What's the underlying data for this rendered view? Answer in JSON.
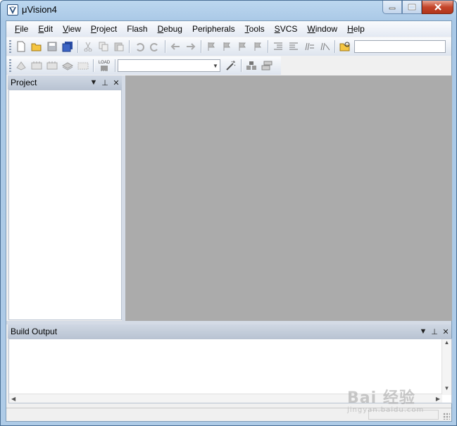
{
  "window": {
    "title": "μVision4"
  },
  "menu": [
    {
      "label": "File",
      "accel": "F",
      "rest": "ile"
    },
    {
      "label": "Edit",
      "accel": "E",
      "rest": "dit"
    },
    {
      "label": "View",
      "accel": "V",
      "rest": "iew"
    },
    {
      "label": "Project",
      "accel": "P",
      "rest": "roject"
    },
    {
      "label": "Flash",
      "accel": "",
      "rest": "Flash"
    },
    {
      "label": "Debug",
      "accel": "D",
      "rest": "ebug"
    },
    {
      "label": "Peripherals",
      "accel": "",
      "rest": "Peripherals"
    },
    {
      "label": "Tools",
      "accel": "T",
      "rest": "ools"
    },
    {
      "label": "SVCS",
      "accel": "S",
      "rest": "VCS"
    },
    {
      "label": "Window",
      "accel": "W",
      "rest": "indow"
    },
    {
      "label": "Help",
      "accel": "H",
      "rest": "elp"
    }
  ],
  "toolbar2": {
    "load_label": "LOAD",
    "target_value": ""
  },
  "project_panel": {
    "title": "Project"
  },
  "build_panel": {
    "title": "Build Output"
  },
  "watermark": {
    "main": "Bai 经验",
    "sub": "jingyan.baidu.com"
  },
  "colors": {
    "workspace": "#ababab",
    "title_gradient_top": "#bcd7ef",
    "close_button": "#c4452a"
  }
}
